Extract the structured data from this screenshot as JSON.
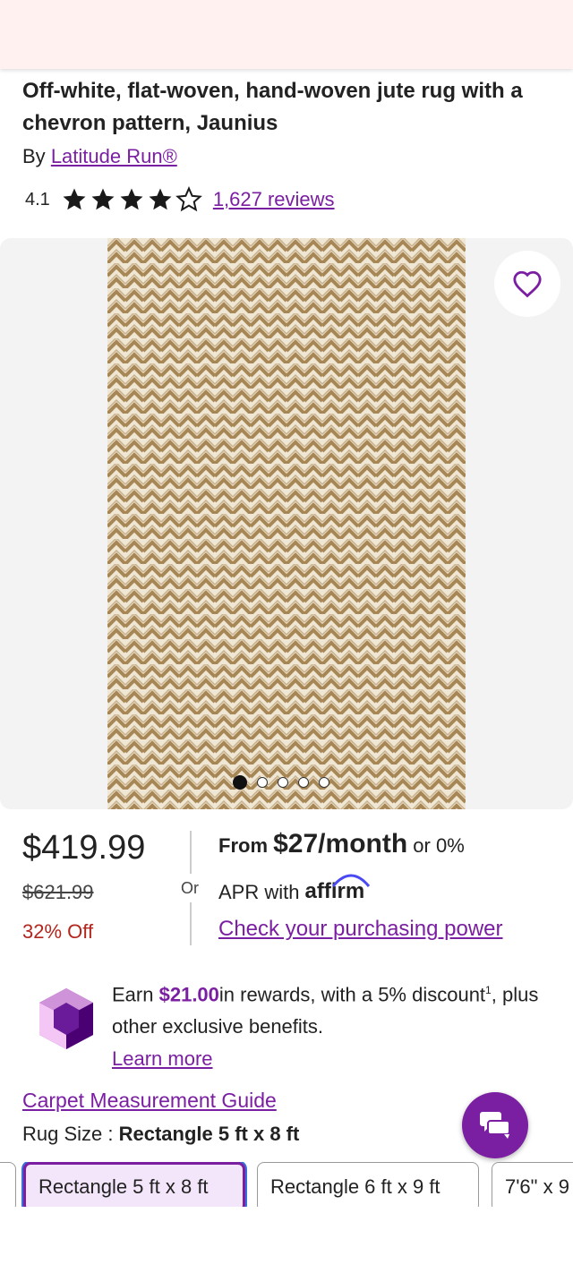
{
  "product": {
    "title": "Off-white, flat-woven, hand-woven jute rug with a chevron pattern, Jaunius",
    "by_prefix": "By",
    "brand": "Latitude Run®",
    "rating": "4.1",
    "rating_stars": 4,
    "reviews": "1,627 reviews"
  },
  "gallery": {
    "image_count": 5,
    "active_index": 0
  },
  "pricing": {
    "price": "$419.99",
    "was_price": "$621.99",
    "discount": "32% Off",
    "or_label": "Or",
    "from_prefix": "From",
    "monthly": "$27/month",
    "or_apr": "or 0%",
    "apr_with": "APR with",
    "affirm": "affirm",
    "purchasing_power": "Check your purchasing power"
  },
  "rewards": {
    "earn": "Earn",
    "amount": "$21.00",
    "text": "in rewards, with a 5% discount",
    "footnote": "1",
    "line2": ", plus other exclusive benefits.",
    "learn_more": "Learn more"
  },
  "size": {
    "guide": "Carpet Measurement Guide",
    "label": "Rug Size : ",
    "selected": "Rectangle 5 ft x 8 ft",
    "options": [
      "Rectangle 5 ft x 8 ft",
      "Rectangle 6 ft x 9 ft",
      "7'6\" x 9"
    ]
  },
  "colors": {
    "accent": "#7b1fa2",
    "discount": "#b3261e",
    "header": "#fff1f0"
  }
}
